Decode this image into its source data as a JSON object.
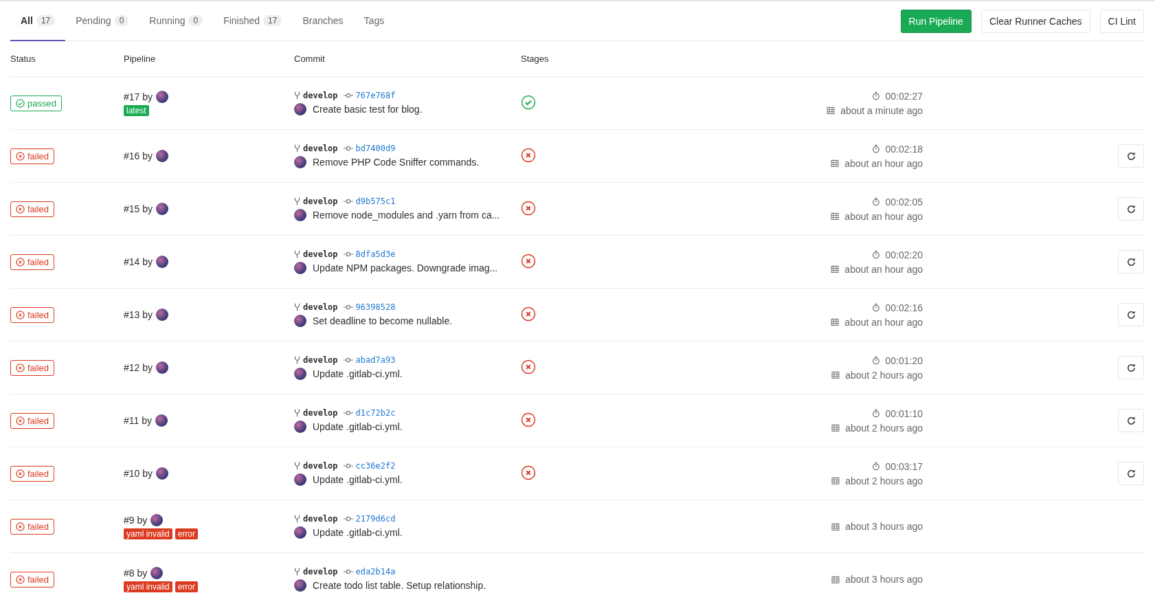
{
  "tabs": [
    {
      "label": "All",
      "count": "17",
      "selected": true
    },
    {
      "label": "Pending",
      "count": "0",
      "selected": false
    },
    {
      "label": "Running",
      "count": "0",
      "selected": false
    },
    {
      "label": "Finished",
      "count": "17",
      "selected": false
    },
    {
      "label": "Branches",
      "selected": false
    },
    {
      "label": "Tags",
      "selected": false
    }
  ],
  "actions": [
    {
      "label": "Run Pipeline",
      "kind": "primary"
    },
    {
      "label": "Clear Runner Caches",
      "kind": "default"
    },
    {
      "label": "CI Lint",
      "kind": "default"
    }
  ],
  "table": {
    "columns": [
      "Status",
      "Pipeline",
      "Commit",
      "Stages"
    ],
    "rows": [
      {
        "status": {
          "label": "passed",
          "kind": "passed"
        },
        "pipeline": "#17 by",
        "tags": [
          {
            "label": "latest",
            "kind": "success"
          }
        ],
        "branch": "develop",
        "sha": "767e768f",
        "message": "Create basic test for blog.",
        "stage_passed": true,
        "duration": "00:02:27",
        "time": "about a minute ago",
        "retry": false
      },
      {
        "status": {
          "label": "failed",
          "kind": "failed"
        },
        "pipeline": "#16 by",
        "branch": "develop",
        "sha": "bd7400d9",
        "message": "Remove PHP Code Sniffer commands.",
        "stage_passed": false,
        "duration": "00:02:18",
        "time": "about an hour ago",
        "retry": true
      },
      {
        "status": {
          "label": "failed",
          "kind": "failed"
        },
        "pipeline": "#15 by",
        "branch": "develop",
        "sha": "d9b575c1",
        "message": "Remove node_modules and .yarn from ca...",
        "stage_passed": false,
        "duration": "00:02:05",
        "time": "about an hour ago",
        "retry": true
      },
      {
        "status": {
          "label": "failed",
          "kind": "failed"
        },
        "pipeline": "#14 by",
        "branch": "develop",
        "sha": "8dfa5d3e",
        "message": "Update NPM packages. Downgrade imag...",
        "stage_passed": false,
        "duration": "00:02:20",
        "time": "about an hour ago",
        "retry": true
      },
      {
        "status": {
          "label": "failed",
          "kind": "failed"
        },
        "pipeline": "#13 by",
        "branch": "develop",
        "sha": "96398528",
        "message": "Set deadline to become nullable.",
        "stage_passed": false,
        "duration": "00:02:16",
        "time": "about an hour ago",
        "retry": true
      },
      {
        "status": {
          "label": "failed",
          "kind": "failed"
        },
        "pipeline": "#12 by",
        "branch": "develop",
        "sha": "abad7a93",
        "message": "Update .gitlab-ci.yml.",
        "stage_passed": false,
        "duration": "00:01:20",
        "time": "about 2 hours ago",
        "retry": true
      },
      {
        "status": {
          "label": "failed",
          "kind": "failed"
        },
        "pipeline": "#11 by",
        "branch": "develop",
        "sha": "d1c72b2c",
        "message": "Update .gitlab-ci.yml.",
        "stage_passed": false,
        "duration": "00:01:10",
        "time": "about 2 hours ago",
        "retry": true
      },
      {
        "status": {
          "label": "failed",
          "kind": "failed"
        },
        "pipeline": "#10 by",
        "branch": "develop",
        "sha": "cc36e2f2",
        "message": "Update .gitlab-ci.yml.",
        "stage_passed": false,
        "duration": "00:03:17",
        "time": "about 2 hours ago",
        "retry": true
      },
      {
        "status": {
          "label": "failed",
          "kind": "failed"
        },
        "pipeline": "#9 by",
        "tags": [
          {
            "label": "yaml invalid",
            "kind": "danger"
          },
          {
            "label": "error",
            "kind": "danger"
          }
        ],
        "branch": "develop",
        "sha": "2179d6cd",
        "message": "Update .gitlab-ci.yml.",
        "time": "about 3 hours ago",
        "retry": false
      },
      {
        "status": {
          "label": "failed",
          "kind": "failed"
        },
        "pipeline": "#8 by",
        "tags": [
          {
            "label": "yaml invalid",
            "kind": "danger"
          },
          {
            "label": "error",
            "kind": "danger"
          }
        ],
        "branch": "develop",
        "sha": "eda2b14a",
        "message": "Create todo list table. Setup relationship.",
        "time": "about 3 hours ago",
        "retry": false
      }
    ]
  }
}
